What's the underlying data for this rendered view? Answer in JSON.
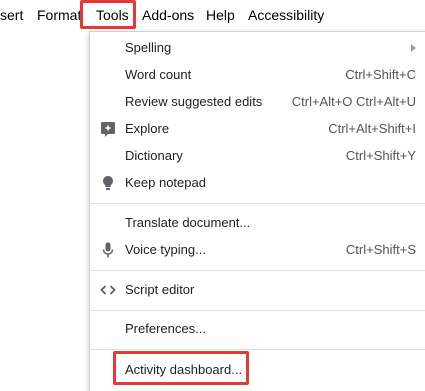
{
  "menubar": {
    "items": [
      {
        "label": "sert"
      },
      {
        "label": "Format"
      },
      {
        "label": "Tools"
      },
      {
        "label": "Add-ons"
      },
      {
        "label": "Help"
      },
      {
        "label": "Accessibility"
      }
    ]
  },
  "tools_menu": {
    "items": [
      {
        "label": "Spelling",
        "shortcut": "",
        "submenu": true
      },
      {
        "label": "Word count",
        "shortcut": "Ctrl+Shift+C"
      },
      {
        "label": "Review suggested edits",
        "shortcut": "Ctrl+Alt+O Ctrl+Alt+U"
      },
      {
        "label": "Explore",
        "shortcut": "Ctrl+Alt+Shift+I",
        "icon": "explore-icon"
      },
      {
        "label": "Dictionary",
        "shortcut": "Ctrl+Shift+Y"
      },
      {
        "label": "Keep notepad",
        "shortcut": "",
        "icon": "lightbulb-icon"
      },
      {
        "label": "Translate document...",
        "shortcut": ""
      },
      {
        "label": "Voice typing...",
        "shortcut": "Ctrl+Shift+S",
        "icon": "microphone-icon"
      },
      {
        "label": "Script editor",
        "shortcut": "",
        "icon": "code-icon"
      },
      {
        "label": "Preferences...",
        "shortcut": ""
      },
      {
        "label": "Activity dashboard...",
        "shortcut": ""
      }
    ]
  },
  "colors": {
    "highlight": "#e53935",
    "separator": "#e0e0e0",
    "icon": "#5f6368"
  }
}
